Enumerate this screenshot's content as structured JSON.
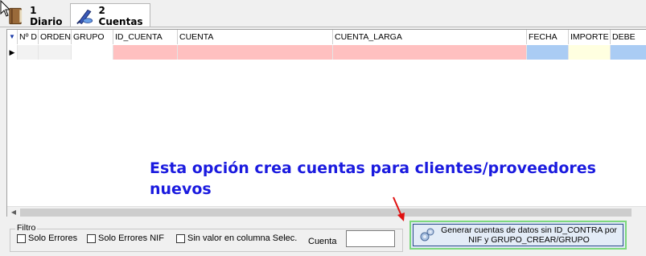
{
  "tabs": [
    {
      "label": "1 Diario",
      "icon": "book-icon",
      "active": false
    },
    {
      "label": "2 Cuentas",
      "icon": "quill-pen-icon",
      "active": true
    }
  ],
  "grid": {
    "columns": [
      "Nº D",
      "ORDEN",
      "GRUPO",
      "ID_CUENTA",
      "CUENTA",
      "CUENTA_LARGA",
      "FECHA",
      "IMPORTE",
      "DEBE"
    ],
    "row_indicator": "▶",
    "column_colors": {
      "pink": "#ffc0c0",
      "blue": "#aaccf4",
      "yellow": "#ffffe0"
    }
  },
  "message": {
    "line1": "Esta opción crea cuentas para clientes/proveedores",
    "line2": "nuevos",
    "color": "#1a1adf"
  },
  "filter": {
    "label": "Filtro",
    "checks": [
      "Solo Errores",
      "Solo Errores NIF",
      "Sin valor en columna Selec."
    ],
    "cuenta_label": "Cuenta",
    "cuenta_value": ""
  },
  "generate_button": {
    "line1": "Generar cuentas de datos sin ID_CONTRA por",
    "line2": "NIF y GRUPO_CREAR/GRUPO",
    "icon": "gears-icon"
  },
  "annotation_arrow": {
    "color": "#e01010"
  }
}
